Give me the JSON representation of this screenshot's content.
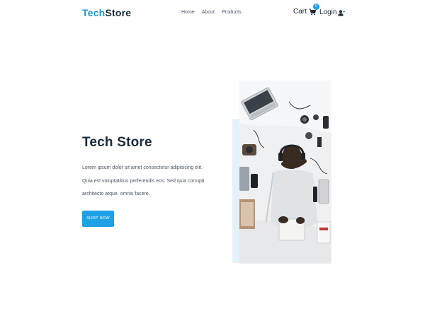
{
  "header": {
    "logo_part1": "Tech",
    "logo_part2": "Store",
    "nav": [
      "Home",
      "About",
      "Products"
    ],
    "cart_label": "Cart",
    "cart_count": "0",
    "login_label": "Login"
  },
  "hero": {
    "title": "Tech Store",
    "description": "Lorem ipsum dolor sit amet consectetur adipisicing elit. Quia est voluptatibus perferendis eos. Sed quia corrupti architecto atque, omnis facere.",
    "button_label": "SHOP NOW"
  },
  "icons": {
    "cart": "shopping-cart-icon",
    "login": "user-plus-icon"
  },
  "colors": {
    "accent": "#1798d6",
    "button": "#1ea0e6",
    "text_dark": "#1b2b3a",
    "image_backdrop": "#e4f1f9"
  }
}
